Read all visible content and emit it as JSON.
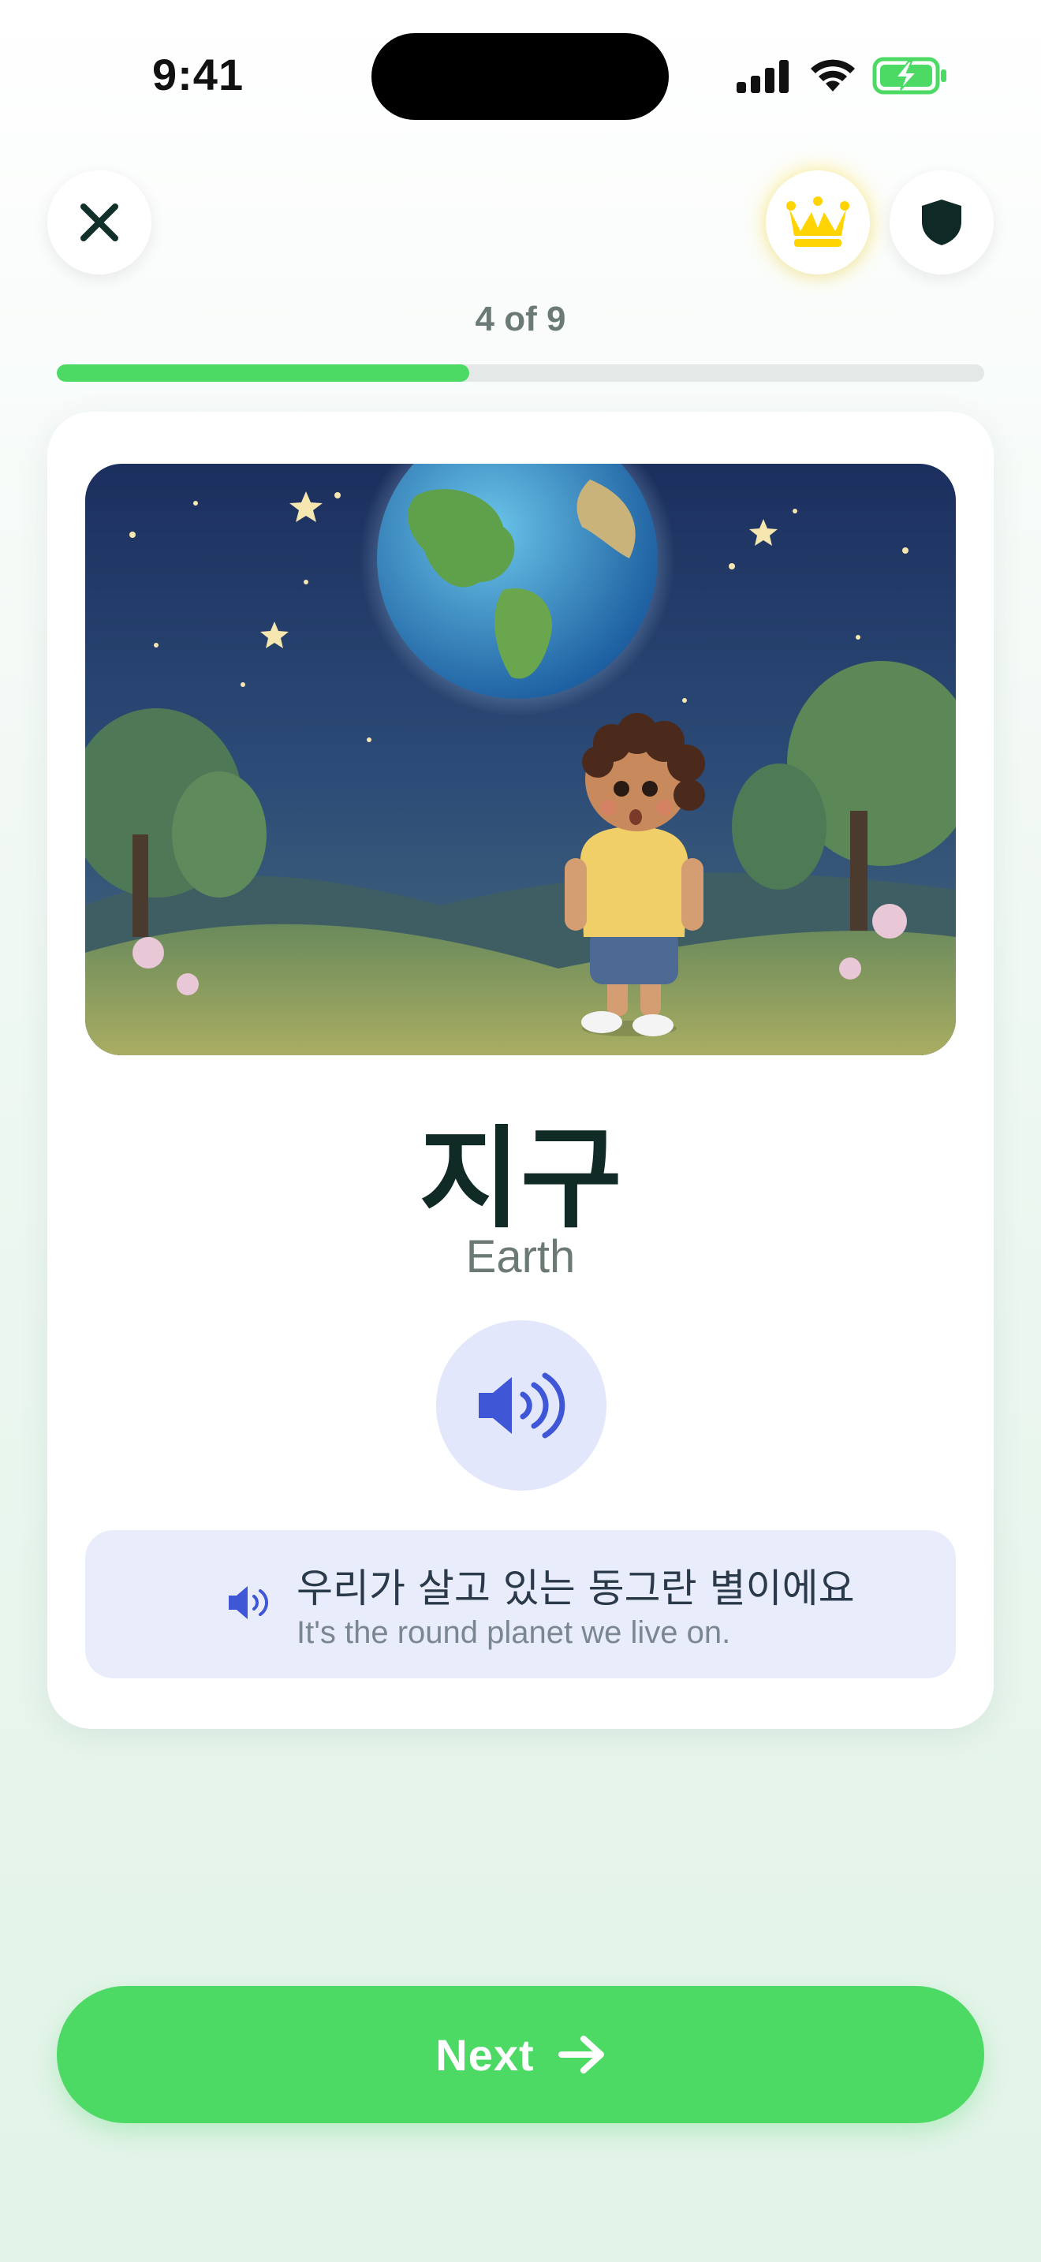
{
  "status_bar": {
    "time": "9:41"
  },
  "header": {
    "close_icon": "close-icon",
    "premium_icon": "crown-icon",
    "shield_icon": "shield-icon",
    "progress_label": "4 of 9",
    "progress": {
      "current": 4,
      "total": 9
    }
  },
  "card": {
    "image_description_icon": "earth-night-illustration",
    "word": "지구",
    "translation": "Earth",
    "audio_icon": "speaker-icon",
    "example": {
      "korean": "우리가 살고 있는 동그란 별이에요",
      "english": "It's the round planet we live on."
    }
  },
  "footer": {
    "next_label": "Next",
    "next_icon": "arrow-right-icon"
  },
  "colors": {
    "accent_green": "#4cd964",
    "audio_blue": "#3f56d6",
    "crown_yellow": "#ffd400"
  }
}
